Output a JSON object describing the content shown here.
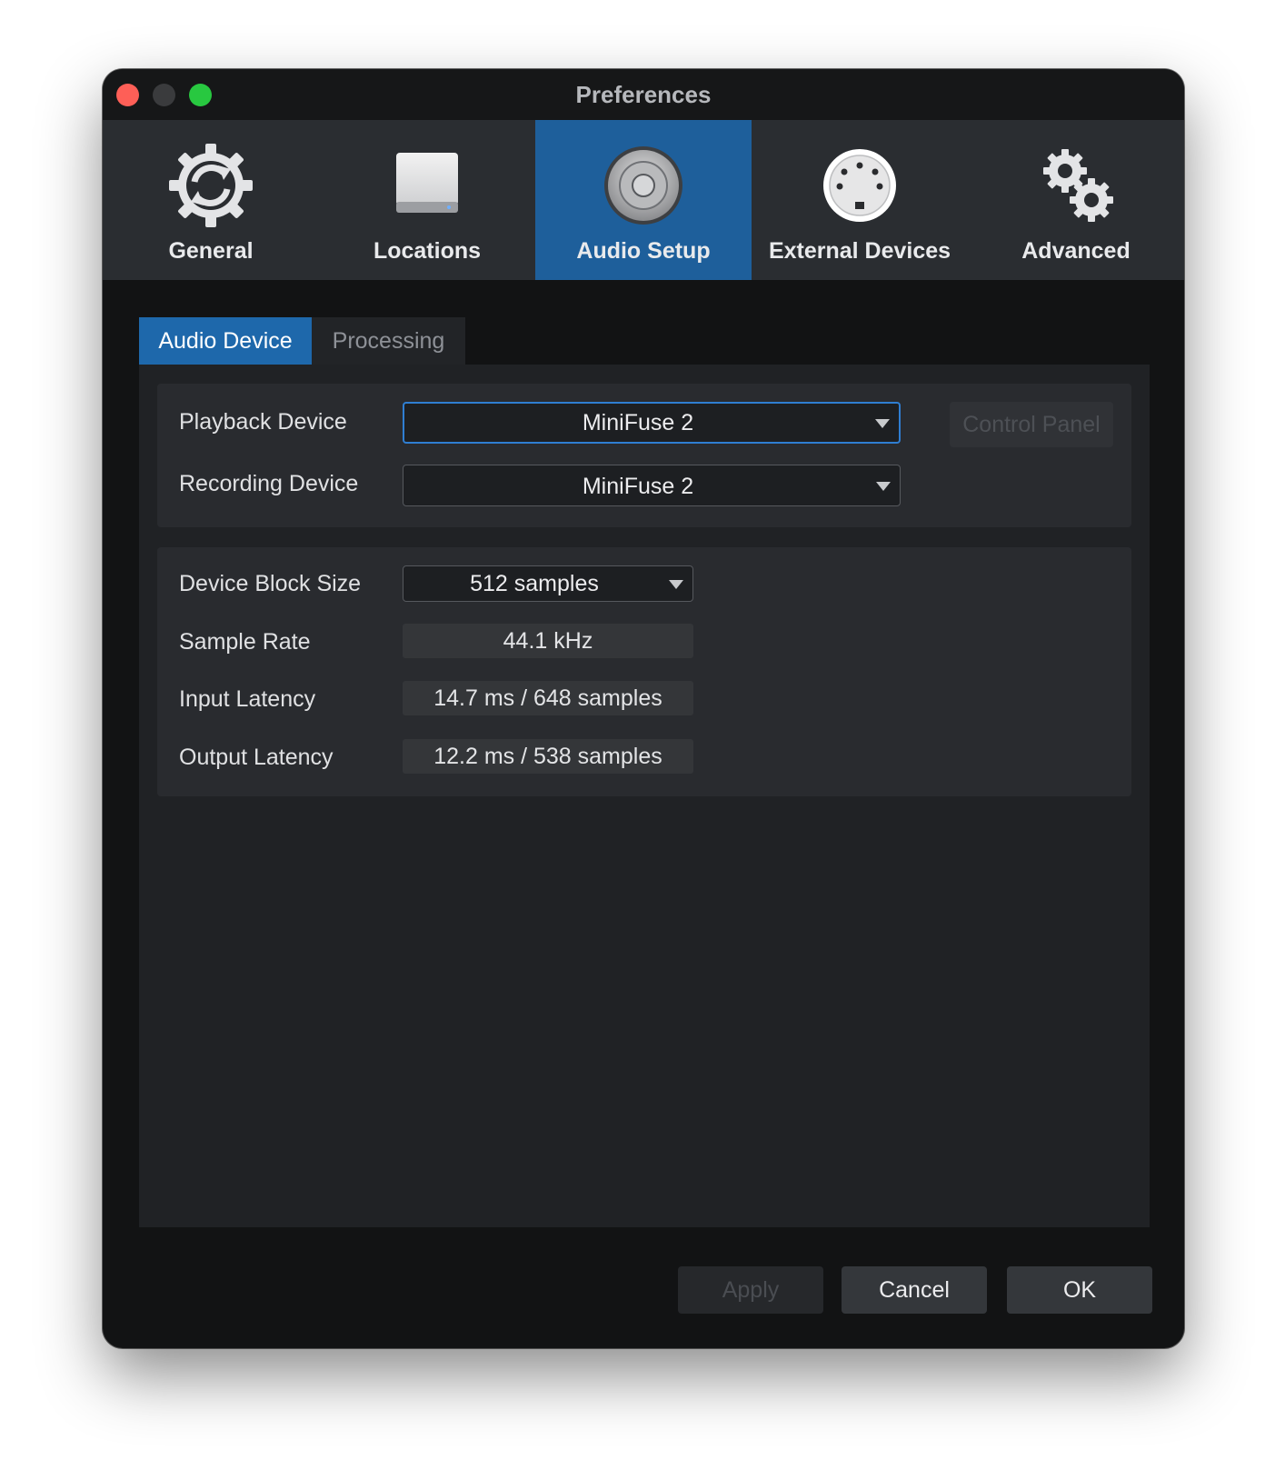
{
  "window": {
    "title": "Preferences"
  },
  "toolbar": {
    "items": [
      {
        "label": "General",
        "icon": "general-gear-refresh-icon",
        "active": false
      },
      {
        "label": "Locations",
        "icon": "hard-drive-icon",
        "active": false
      },
      {
        "label": "Audio Setup",
        "icon": "speaker-icon",
        "active": true
      },
      {
        "label": "External Devices",
        "icon": "midi-port-icon",
        "active": false
      },
      {
        "label": "Advanced",
        "icon": "gears-icon",
        "active": false
      }
    ]
  },
  "tabs": [
    {
      "label": "Audio Device",
      "active": true
    },
    {
      "label": "Processing",
      "active": false
    }
  ],
  "devices": {
    "playback_label": "Playback Device",
    "playback_value": "MiniFuse 2",
    "recording_label": "Recording Device",
    "recording_value": "MiniFuse 2",
    "control_panel_label": "Control Panel"
  },
  "settings": {
    "block_size_label": "Device Block Size",
    "block_size_value": "512 samples",
    "sample_rate_label": "Sample Rate",
    "sample_rate_value": "44.1 kHz",
    "input_latency_label": "Input Latency",
    "input_latency_value": "14.7 ms / 648 samples",
    "output_latency_label": "Output Latency",
    "output_latency_value": "12.2 ms / 538 samples"
  },
  "buttons": {
    "apply": "Apply",
    "cancel": "Cancel",
    "ok": "OK"
  },
  "colors": {
    "accent": "#1e5f9b",
    "tab_active": "#1e68ab",
    "focus_border": "#2f7ed2",
    "window_bg": "#121314"
  }
}
